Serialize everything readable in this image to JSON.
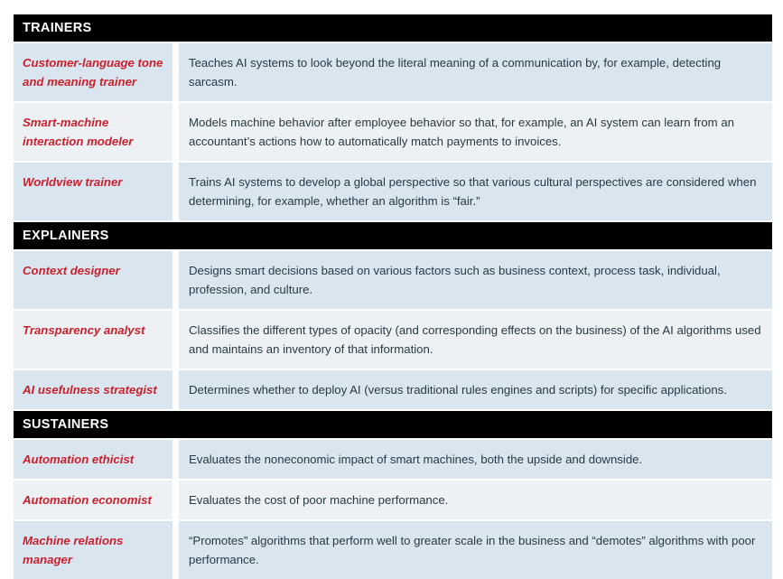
{
  "table": {
    "sections": [
      {
        "header": "TRAINERS",
        "rows": [
          {
            "role": "Customer-language tone and meaning trainer",
            "description": "Teaches AI systems to look beyond the literal meaning of a communication by, for example, detecting sarcasm.",
            "lines": 2
          },
          {
            "role": "Smart-machine interaction modeler",
            "description": "Models machine behavior after employee behavior so that, for example, an AI system can learn from an accountant’s actions how to automatically match payments to invoices.",
            "lines": 2
          },
          {
            "role": "Worldview trainer",
            "description": "Trains AI systems to develop a global perspective so that various cultural perspectives are considered when determining, for example, whether an algorithm is “fair.”",
            "lines": 2
          }
        ]
      },
      {
        "header": "EXPLAINERS",
        "rows": [
          {
            "role": "Context designer",
            "description": "Designs smart decisions based on various factors such as business context, process task, individual, profession, and culture.",
            "lines": 2
          },
          {
            "role": "Transparency analyst",
            "description": "Classifies the different types of opacity (and corresponding effects on the business) of the AI algorithms used and maintains an inventory of that information.",
            "lines": 2
          },
          {
            "role": "AI usefulness strategist",
            "description": "Determines whether to deploy AI (versus traditional rules engines and scripts) for specific applications.",
            "lines": 1
          }
        ]
      },
      {
        "header": "SUSTAINERS",
        "rows": [
          {
            "role": "Automation ethicist",
            "description": "Evaluates the noneconomic impact of smart machines, both the upside and downside.",
            "lines": 1
          },
          {
            "role": "Automation economist",
            "description": "Evaluates the cost of poor machine performance.",
            "lines": 1
          },
          {
            "role": "Machine relations manager",
            "description": "“Promotes” algorithms that perform well to greater scale in the business and “demotes” algorithms with poor performance.",
            "lines": 2
          }
        ]
      }
    ]
  },
  "colors": {
    "header_background": "#000000",
    "header_text": "#ffffff",
    "role_text": "#ca1f2c",
    "description_text": "#273a45",
    "row_background_odd": "#d9e5ef",
    "row_background_even": "#edf1f4",
    "page_background": "#ffffff"
  }
}
